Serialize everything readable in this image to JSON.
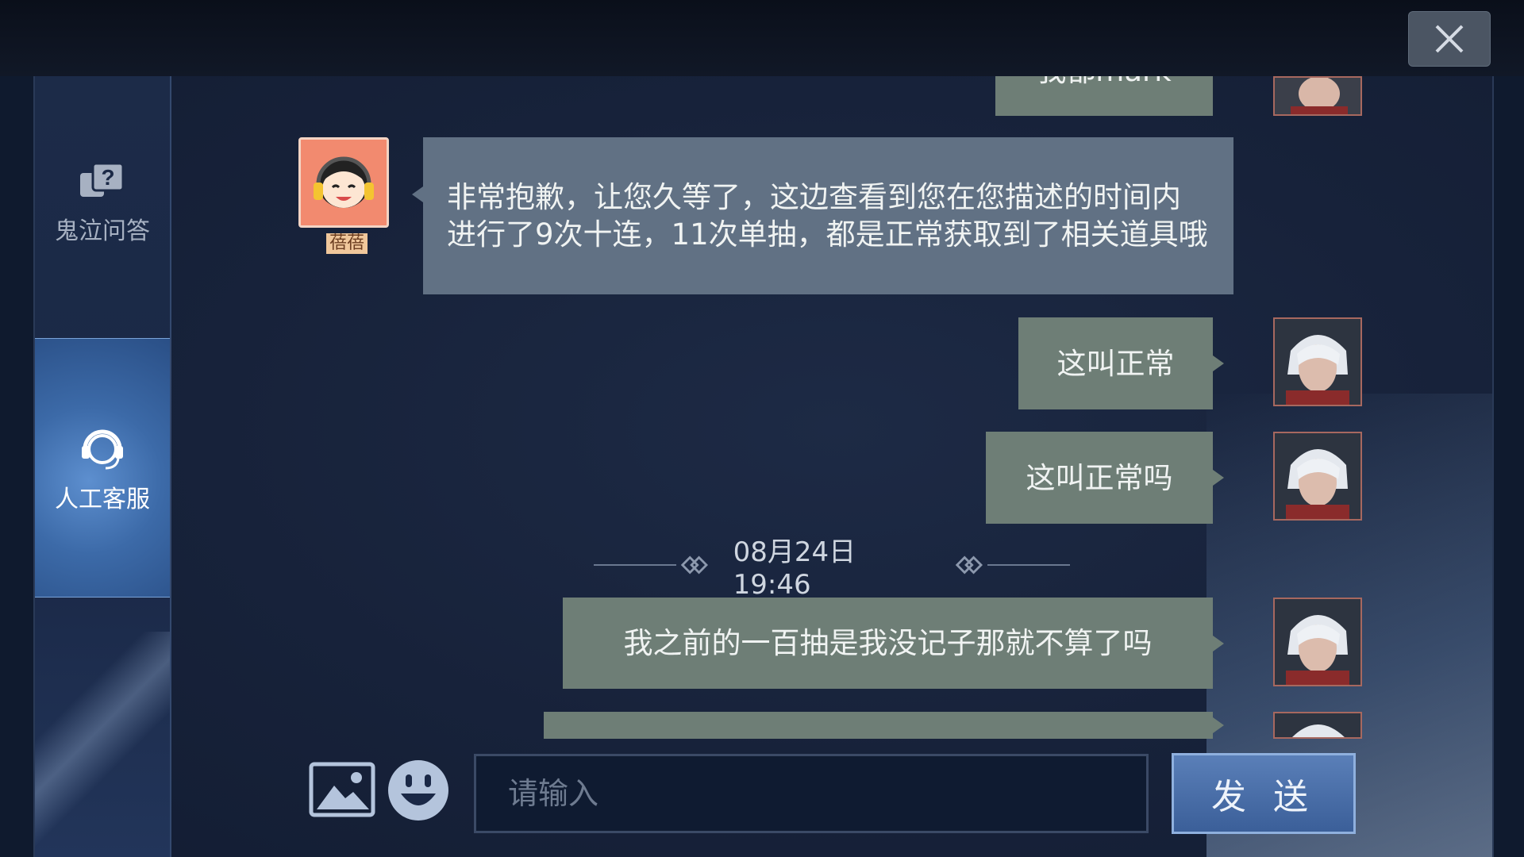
{
  "window": {
    "close_icon": "close-icon"
  },
  "sidebar": {
    "items": [
      {
        "label": "鬼泣问答",
        "icon": "question-bubbles-icon"
      },
      {
        "label": "人工客服",
        "icon": "headset-icon"
      }
    ]
  },
  "chat": {
    "top_partial_text": "我都mark",
    "agent": {
      "name": "蓓蓓",
      "message": "非常抱歉，让您久等了，这边查看到您在您描述的时间内进行了9次十连，11次单抽，都是正常获取到了相关道具哦"
    },
    "user_messages": [
      "这叫正常",
      "这叫正常吗"
    ],
    "timestamp": "08月24日 19:46",
    "user_messages_after": [
      "我之前的一百抽是我没记子那就不算了吗"
    ]
  },
  "input": {
    "placeholder": "请输入",
    "value": "",
    "send_label": "发 送",
    "image_icon": "image-icon",
    "emoji_icon": "emoji-icon"
  },
  "colors": {
    "user_bubble": "#6e7e76",
    "agent_bubble": "#617184",
    "send_button": "#4a6fa8",
    "background": "#17223a"
  }
}
